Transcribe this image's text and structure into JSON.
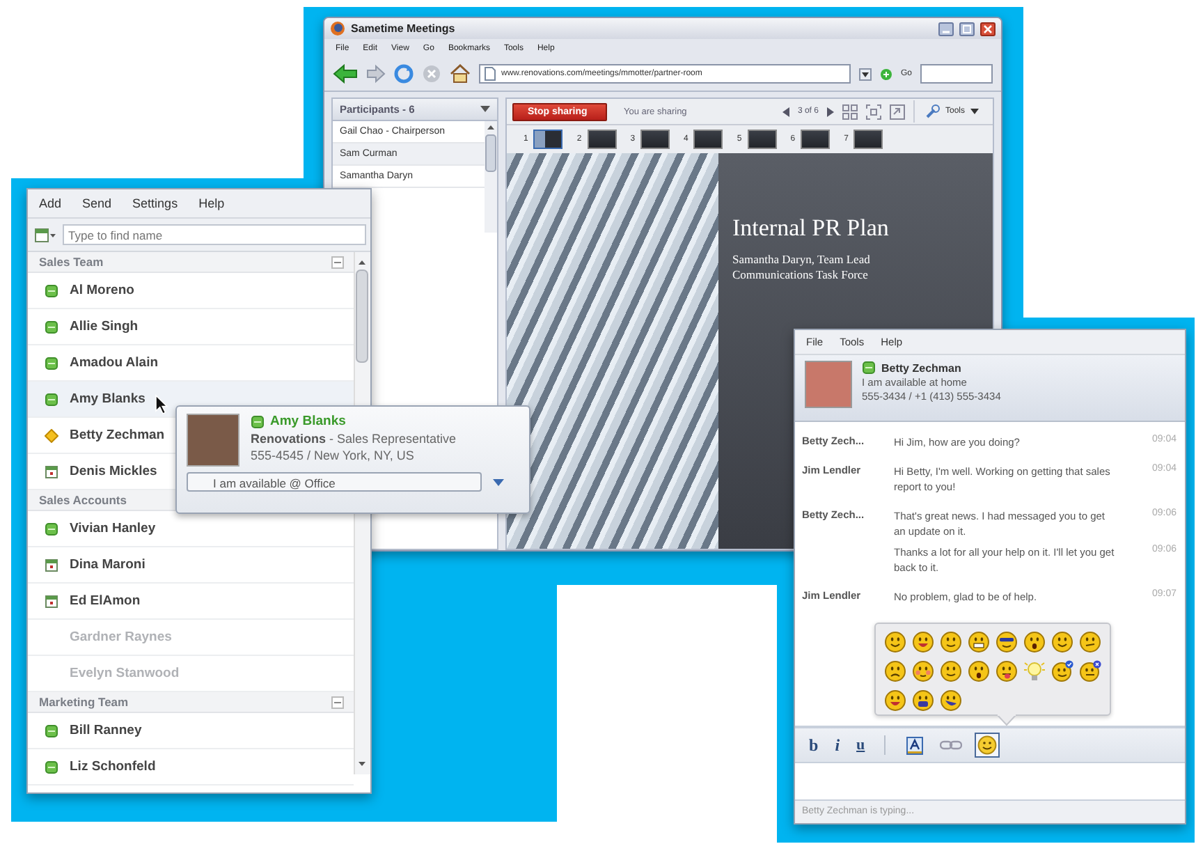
{
  "meeting_window": {
    "title": "Sametime Meetings",
    "menu": [
      "File",
      "Edit",
      "View",
      "Go",
      "Bookmarks",
      "Tools",
      "Help"
    ],
    "address": "www.renovations.com/meetings/mmotter/partner-room",
    "go_label": "Go",
    "participants": {
      "title": "Participants - 6",
      "items": [
        {
          "name": "Gail Chao - Chairperson",
          "selected": false
        },
        {
          "name": "Sam Curman",
          "selected": true
        },
        {
          "name": "Samantha Daryn",
          "selected": false
        }
      ]
    },
    "stop_sharing": "Stop sharing",
    "sharing_status": "You are sharing",
    "page_indicator": "3 of 6",
    "tools_label": "Tools",
    "thumbnails": [
      {
        "number": "1",
        "selected": true
      },
      {
        "number": "2",
        "selected": false
      },
      {
        "number": "3",
        "selected": false
      },
      {
        "number": "4",
        "selected": false
      },
      {
        "number": "5",
        "selected": false
      },
      {
        "number": "6",
        "selected": false
      },
      {
        "number": "7",
        "selected": false
      }
    ],
    "slide": {
      "title": "Internal PR Plan",
      "subtitle_lines": [
        "Samantha Daryn, Team Lead",
        "Communications Task Force"
      ]
    }
  },
  "contacts_window": {
    "menu": [
      "Add",
      "Send",
      "Settings",
      "Help"
    ],
    "search": {
      "placeholder": "Type to find name"
    },
    "groups": [
      {
        "name": "Sales Team",
        "expanded": true,
        "contacts": [
          {
            "name": "Al Moreno",
            "kind": "available",
            "selected": false
          },
          {
            "name": "Allie Singh",
            "kind": "available",
            "selected": false
          },
          {
            "name": "Amadou Alain",
            "kind": "available",
            "selected": false
          },
          {
            "name": "Amy Blanks",
            "kind": "available",
            "selected": true
          },
          {
            "name": "Betty Zechman",
            "kind": "away",
            "selected": false
          },
          {
            "name": "Denis Mickles",
            "kind": "meeting",
            "selected": false
          }
        ]
      },
      {
        "name": "Sales Accounts",
        "expanded": true,
        "contacts": [
          {
            "name": "Vivian Hanley",
            "kind": "available",
            "selected": false
          },
          {
            "name": "Dina Maroni",
            "kind": "meeting",
            "selected": false
          },
          {
            "name": "Ed ElAmon",
            "kind": "meeting",
            "selected": false
          },
          {
            "name": "Gardner Raynes",
            "kind": "offline",
            "selected": false
          },
          {
            "name": "Evelyn Stanwood",
            "kind": "offline",
            "selected": false
          }
        ]
      },
      {
        "name": "Marketing Team",
        "expanded": true,
        "contacts": [
          {
            "name": "Bill Ranney",
            "kind": "available",
            "selected": false
          },
          {
            "name": "Liz Schonfeld",
            "kind": "available",
            "selected": false
          }
        ]
      }
    ],
    "tooltip": {
      "name": "Amy Blanks",
      "kind": "available",
      "company_role": "**Renovations** - Sales Representative",
      "contact": "555-4545 / New York, NY, US",
      "status_message": "I am available @ Office"
    }
  },
  "chat_window": {
    "menu": [
      "File",
      "Tools",
      "Help"
    ],
    "contact": {
      "name": "Betty Zechman",
      "kind": "available",
      "status_message": "I am available at home",
      "phone": "555-3434 / +1 (413) 555-3434"
    },
    "messages": [
      {
        "sender": "Betty Zech...",
        "text": "Hi Jim, how are you doing?",
        "time": "09:04"
      },
      {
        "sender": "Jim Lendler",
        "text": "Hi Betty, I'm well.  Working on getting that sales report to you!",
        "time": "09:04"
      },
      {
        "sender": "Betty Zech...",
        "text": "That's great news. I had messaged you to get an update on it.",
        "time": "09:06"
      },
      {
        "text": "Thanks a lot for all your help on it. I'll let you get back to it.",
        "time": "09:06"
      },
      {
        "sender": "Jim Lendler",
        "text": "No problem, glad to be of help.",
        "time": "09:07"
      }
    ],
    "format_buttons": [
      {
        "label": "b",
        "kind": "bold"
      },
      {
        "label": "i",
        "kind": "italic"
      },
      {
        "label": "u",
        "kind": "underline"
      }
    ],
    "tools": [
      {
        "kind": "font",
        "selected": false
      },
      {
        "kind": "link",
        "selected": false
      },
      {
        "kind": "emoticon",
        "selected": true
      }
    ],
    "typing_status": "Betty Zechman is typing..."
  }
}
